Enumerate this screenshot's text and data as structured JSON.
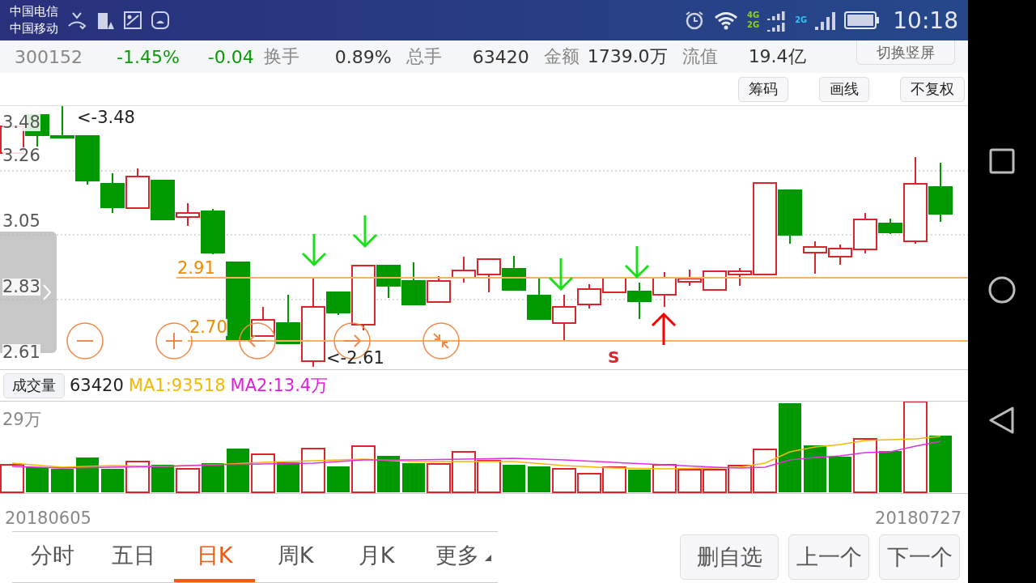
{
  "status_bar": {
    "carriers": [
      "中国电信",
      "中国移动"
    ],
    "network_labels": [
      "4G",
      "2G",
      "2G"
    ],
    "time": "10:18"
  },
  "quote_bar": {
    "code": "300152",
    "change_pct": "-1.45%",
    "change": "-0.04",
    "fields": [
      {
        "label": "换手",
        "value": "0.89%"
      },
      {
        "label": "总手",
        "value": "63420"
      },
      {
        "label": "金额",
        "value": "1739.0万"
      },
      {
        "label": "流值",
        "value": "19.4亿"
      }
    ],
    "orientation_button": "切换竖屏"
  },
  "chart_tools": [
    "筹码",
    "画线",
    "不复权"
  ],
  "price_chart": {
    "y_labels": [
      "3.48",
      "3.26",
      "3.05",
      "2.83",
      "2.61"
    ],
    "high_marker": "<-3.48",
    "low_marker": "<-2.61",
    "lines": [
      {
        "label": "2.91"
      },
      {
        "label": "2.70"
      }
    ],
    "signal": "S"
  },
  "volume": {
    "button": "成交量",
    "value": "63420",
    "ma1": "MA1:93518",
    "ma2": "MA2:13.4万",
    "scale_label": "29万"
  },
  "date_range": {
    "start": "20180605",
    "end": "20180727"
  },
  "period_tabs": [
    {
      "label": "分时",
      "selected": false
    },
    {
      "label": "五日",
      "selected": false
    },
    {
      "label": "日K",
      "selected": true
    },
    {
      "label": "周K",
      "selected": false
    },
    {
      "label": "月K",
      "selected": false
    },
    {
      "label": "更多",
      "selected": false
    }
  ],
  "actions": [
    "删自选",
    "上一个",
    "下一个"
  ]
}
